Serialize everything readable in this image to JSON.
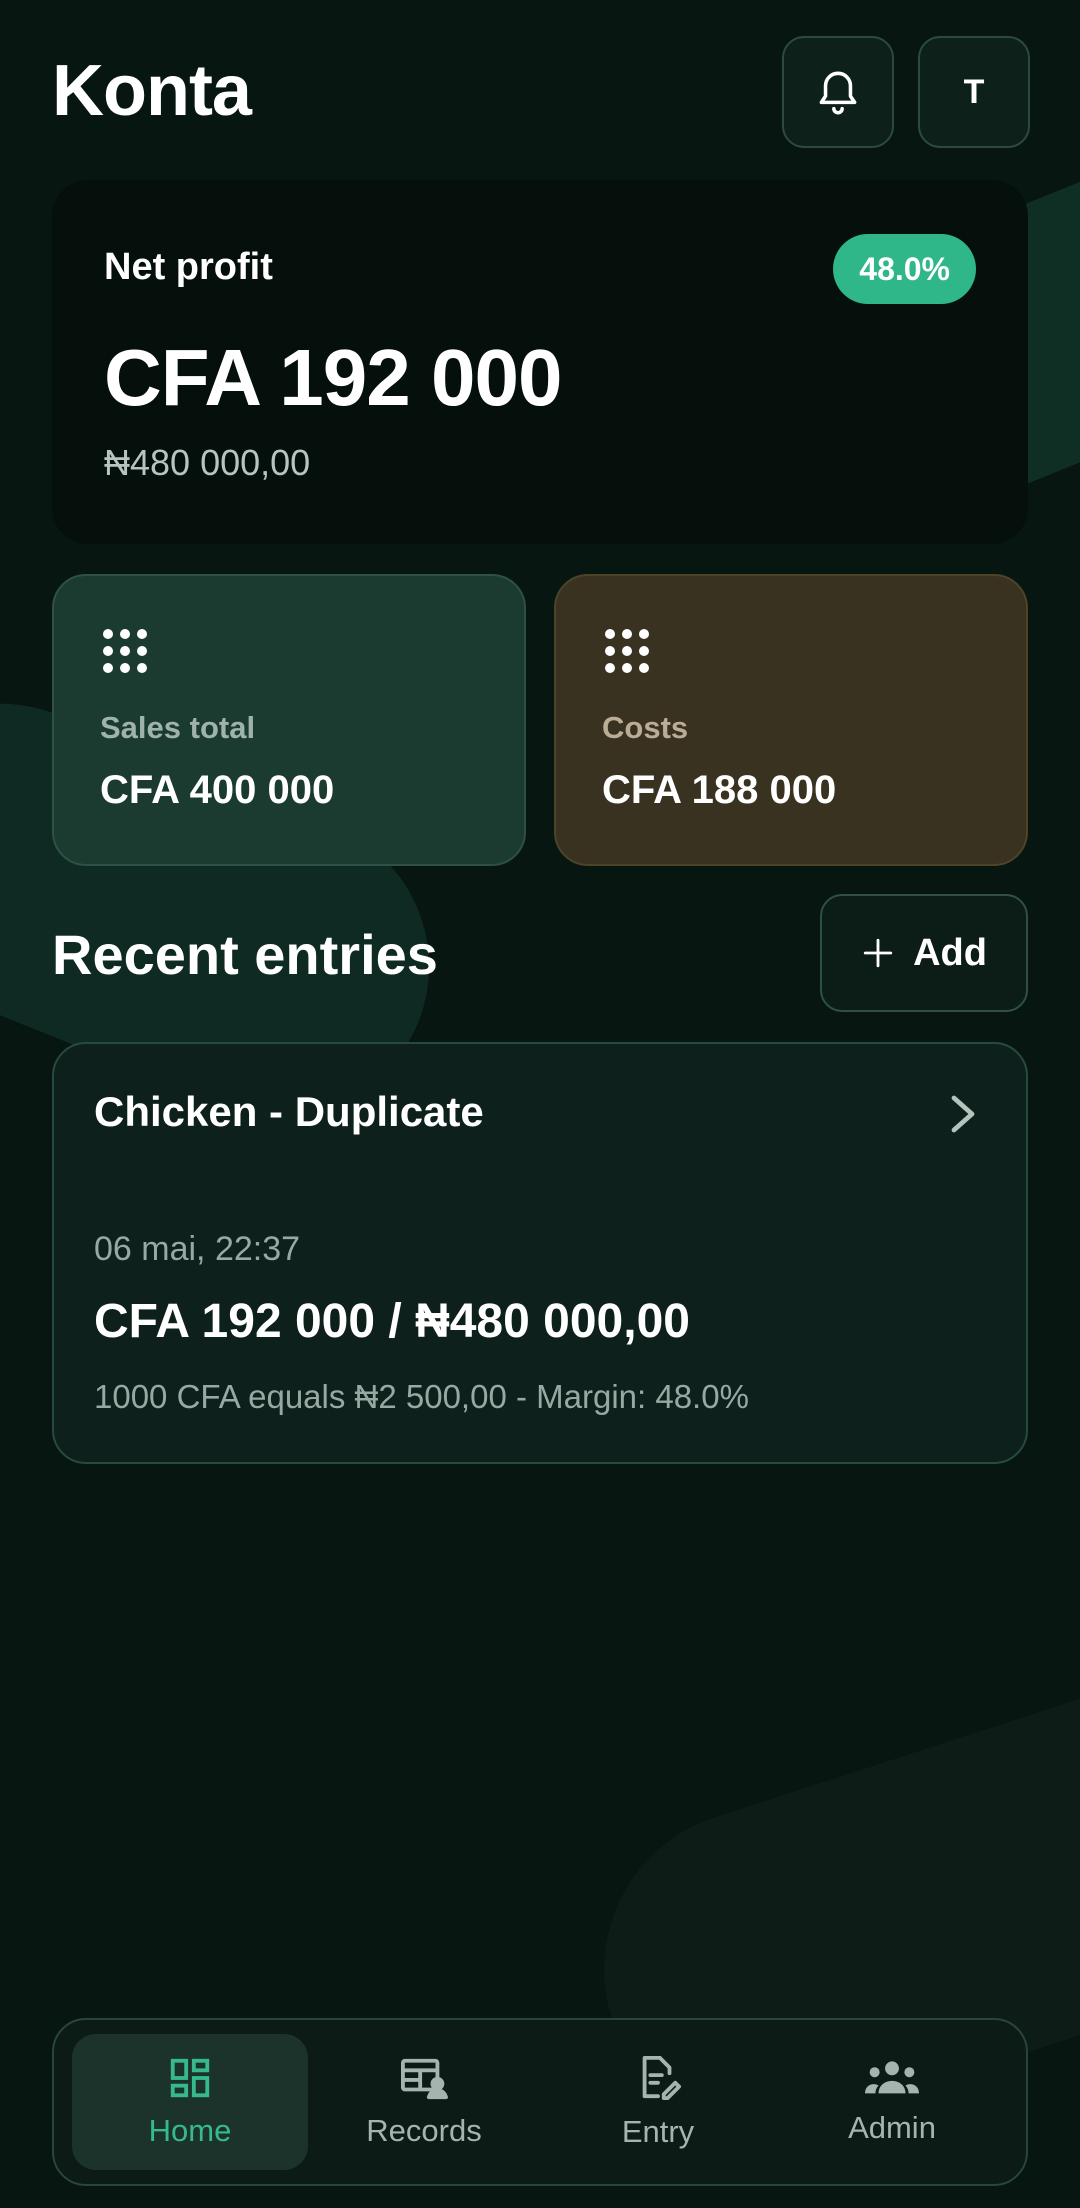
{
  "app": {
    "title": "Konta"
  },
  "header": {
    "avatar_initial": "T"
  },
  "profit": {
    "label": "Net profit",
    "badge": "48.0%",
    "value": "CFA 192 000",
    "converted": "₦480 000,00"
  },
  "stats": {
    "sales": {
      "label": "Sales total",
      "value": "CFA 400 000"
    },
    "costs": {
      "label": "Costs",
      "value": "CFA 188 000"
    }
  },
  "recent": {
    "title": "Recent entries",
    "add_label": "Add",
    "entries": [
      {
        "title": "Chicken - Duplicate",
        "date": "06 mai, 22:37",
        "amount": "CFA 192 000 / ₦480 000,00",
        "meta": "1000 CFA equals ₦2 500,00 - Margin: 48.0%"
      }
    ]
  },
  "nav": {
    "items": [
      {
        "label": "Home",
        "icon": "dashboard-icon",
        "active": true
      },
      {
        "label": "Records",
        "icon": "records-icon",
        "active": false
      },
      {
        "label": "Entry",
        "icon": "edit-document-icon",
        "active": false
      },
      {
        "label": "Admin",
        "icon": "group-icon",
        "active": false
      }
    ]
  },
  "colors": {
    "background": "#081612",
    "accent": "#2fb78a",
    "sales_card": "#1b3b31",
    "costs_card": "#3a3220"
  }
}
